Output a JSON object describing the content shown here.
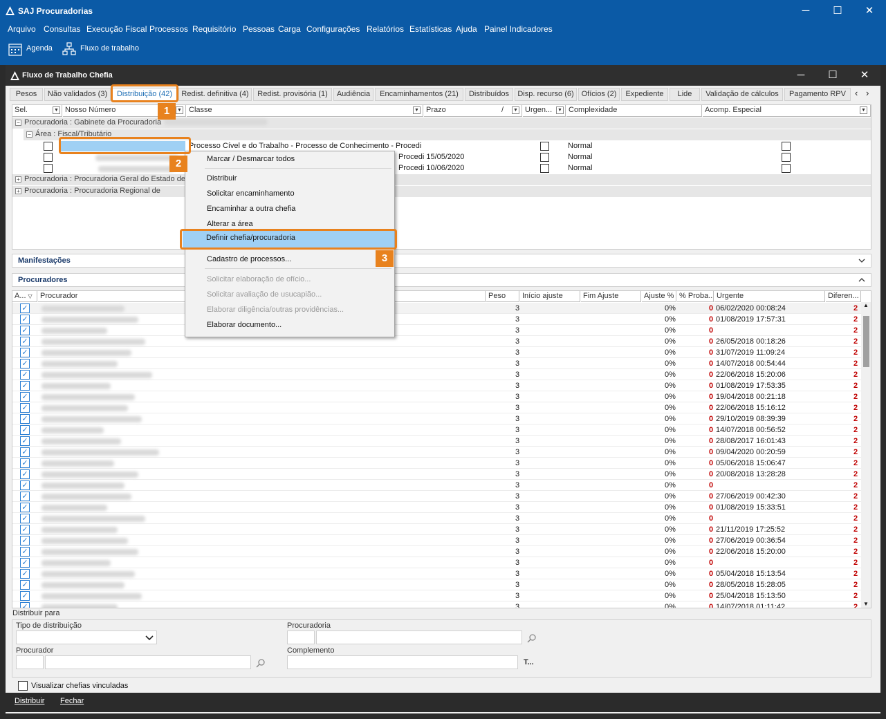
{
  "app": {
    "title": "SAJ Procuradorias",
    "minimize": "─",
    "maximize": "☐",
    "close": "✕"
  },
  "menu": [
    "Arquivo",
    "Consultas",
    "Execução Fiscal",
    "Processos",
    "Requisitório",
    "Pessoas",
    "Carga",
    "Configurações",
    "Relatórios",
    "Estatísticas",
    "Ajuda",
    "Painel Indicadores"
  ],
  "toolbar": {
    "agenda": "Agenda",
    "fluxo": "Fluxo de trabalho"
  },
  "child": {
    "title": "Fluxo de Trabalho Chefia"
  },
  "tabs": [
    "Pesos",
    "Não validados (3)",
    "Distribuição (42)",
    "Redist. definitiva (4)",
    "Redist. provisória (1)",
    "Audiência",
    "Encaminhamentos  (21)",
    "Distribuídos",
    "Disp. recurso (6)",
    "Ofícios (2)",
    "Expediente",
    "Lide",
    "Validação de cálculos",
    "Pagamento RPV"
  ],
  "tab_nav": {
    "prev": "‹",
    "next": "›"
  },
  "grid1": {
    "headers": [
      "Sel.",
      "Nosso Número",
      "Classe",
      "Prazo",
      "/",
      "Urgen...",
      "Complexidade",
      "Acomp. Especial"
    ],
    "groups": [
      "Procuradoria : Gabinete da Procuradoria",
      "Área : Fiscal/Tributário",
      "Procuradoria : Procuradoria Geral do Estado de",
      "Procuradoria : Procuradoria Regional de"
    ],
    "rows": [
      {
        "classe": "Processo Cível e do Trabalho - Processo de Conhecimento - Procedi",
        "complexidade": "Normal"
      },
      {
        "classe": "Procedi 15/05/2020",
        "complexidade": "Normal"
      },
      {
        "classe": "Procedi 10/06/2020",
        "complexidade": "Normal"
      }
    ]
  },
  "sections": {
    "manifestacoes": "Manifestações",
    "procuradores": "Procuradores"
  },
  "grid2": {
    "headers": [
      "A...",
      "Procurador",
      "Peso",
      "Início ajuste",
      "Fim Ajuste",
      "Ajuste %",
      "% Proba...",
      "Urgente",
      "Diferen..."
    ],
    "rows": [
      {
        "peso": "3",
        "ajuste": "0%",
        "urg": "0",
        "data": "06/02/2020 00:08:24",
        "dif": "2"
      },
      {
        "peso": "3",
        "ajuste": "0%",
        "urg": "0",
        "data": "01/08/2019 17:57:31",
        "dif": "2"
      },
      {
        "peso": "3",
        "ajuste": "0%",
        "urg": "0",
        "data": "",
        "dif": "2"
      },
      {
        "peso": "3",
        "ajuste": "0%",
        "urg": "0",
        "data": "26/05/2018 00:18:26",
        "dif": "2"
      },
      {
        "peso": "3",
        "ajuste": "0%",
        "urg": "0",
        "data": "31/07/2019 11:09:24",
        "dif": "2"
      },
      {
        "peso": "3",
        "ajuste": "0%",
        "urg": "0",
        "data": "14/07/2018 00:54:44",
        "dif": "2"
      },
      {
        "peso": "3",
        "ajuste": "0%",
        "urg": "0",
        "data": "22/06/2018 15:20:06",
        "dif": "2"
      },
      {
        "peso": "3",
        "ajuste": "0%",
        "urg": "0",
        "data": "01/08/2019 17:53:35",
        "dif": "2"
      },
      {
        "peso": "3",
        "ajuste": "0%",
        "urg": "0",
        "data": "19/04/2018 00:21:18",
        "dif": "2"
      },
      {
        "peso": "3",
        "ajuste": "0%",
        "urg": "0",
        "data": "22/06/2018 15:16:12",
        "dif": "2"
      },
      {
        "peso": "3",
        "ajuste": "0%",
        "urg": "0",
        "data": "29/10/2019 08:39:39",
        "dif": "2"
      },
      {
        "peso": "3",
        "ajuste": "0%",
        "urg": "0",
        "data": "14/07/2018 00:56:52",
        "dif": "2"
      },
      {
        "peso": "3",
        "ajuste": "0%",
        "urg": "0",
        "data": "28/08/2017 16:01:43",
        "dif": "2"
      },
      {
        "peso": "3",
        "ajuste": "0%",
        "urg": "0",
        "data": "09/04/2020 00:20:59",
        "dif": "2"
      },
      {
        "peso": "3",
        "ajuste": "0%",
        "urg": "0",
        "data": "05/06/2018 15:06:47",
        "dif": "2"
      },
      {
        "peso": "3",
        "ajuste": "0%",
        "urg": "0",
        "data": "20/08/2018 13:28:28",
        "dif": "2"
      },
      {
        "peso": "3",
        "ajuste": "0%",
        "urg": "0",
        "data": "",
        "dif": "2"
      },
      {
        "peso": "3",
        "ajuste": "0%",
        "urg": "0",
        "data": "27/06/2019 00:42:30",
        "dif": "2"
      },
      {
        "peso": "3",
        "ajuste": "0%",
        "urg": "0",
        "data": "01/08/2019 15:33:51",
        "dif": "2"
      },
      {
        "peso": "3",
        "ajuste": "0%",
        "urg": "0",
        "data": "",
        "dif": "2"
      },
      {
        "peso": "3",
        "ajuste": "0%",
        "urg": "0",
        "data": "21/11/2019 17:25:52",
        "dif": "2"
      },
      {
        "peso": "3",
        "ajuste": "0%",
        "urg": "0",
        "data": "27/06/2019 00:36:54",
        "dif": "2"
      },
      {
        "peso": "3",
        "ajuste": "0%",
        "urg": "0",
        "data": "22/06/2018 15:20:00",
        "dif": "2"
      },
      {
        "peso": "3",
        "ajuste": "0%",
        "urg": "0",
        "data": "",
        "dif": "2"
      },
      {
        "peso": "3",
        "ajuste": "0%",
        "urg": "0",
        "data": "05/04/2018 15:13:54",
        "dif": "2"
      },
      {
        "peso": "3",
        "ajuste": "0%",
        "urg": "0",
        "data": "28/05/2018 15:28:05",
        "dif": "2"
      },
      {
        "peso": "3",
        "ajuste": "0%",
        "urg": "0",
        "data": "25/04/2018 15:13:50",
        "dif": "2"
      },
      {
        "peso": "3",
        "ajuste": "0%",
        "urg": "0",
        "data": "14/07/2018 01:11:42",
        "dif": "2"
      }
    ]
  },
  "distribuir_para": {
    "title": "Distribuir para",
    "tipo_label": "Tipo de distribuição",
    "procuradoria_label": "Procuradoria",
    "procurador_label": "Procurador",
    "complemento_label": "Complemento",
    "t_button": "T..."
  },
  "visualizar_chefias": "Visualizar chefias vinculadas",
  "bottom": {
    "distribuir": "Distribuir",
    "fechar": "Fechar"
  },
  "context_menu": [
    {
      "label": "Marcar / Desmarcar todos",
      "enabled": true
    },
    {
      "label": "Distribuir",
      "enabled": true
    },
    {
      "label": "Solicitar encaminhamento",
      "enabled": true
    },
    {
      "label": "Encaminhar a outra chefia",
      "enabled": true
    },
    {
      "label": "Alterar a área",
      "enabled": true
    },
    {
      "label": "Definir chefia/procuradoria",
      "enabled": true,
      "highlighted": true
    },
    {
      "label": "Cadastro de processos...",
      "enabled": true
    },
    {
      "label": "Solicitar elaboração de ofício...",
      "enabled": false
    },
    {
      "label": "Solicitar avaliação de usucapião...",
      "enabled": false
    },
    {
      "label": "Elaborar diligência/outras providências...",
      "enabled": false
    },
    {
      "label": "Elaborar documento...",
      "enabled": true
    }
  ],
  "callouts": [
    "1",
    "2",
    "3"
  ],
  "colors": {
    "titlebar": "#0b5aa6",
    "accent": "#e8821e",
    "highlight": "#9fd0f4",
    "urgent": "#c00000"
  }
}
